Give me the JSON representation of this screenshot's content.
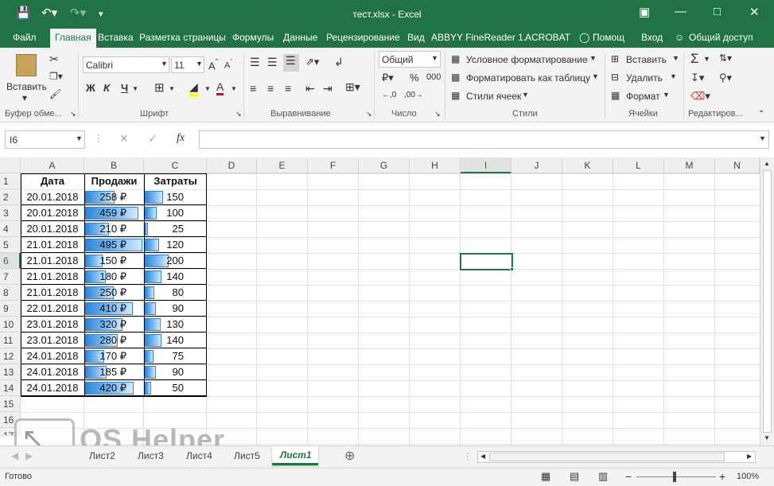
{
  "window": {
    "title": "тест.xlsx - Excel"
  },
  "ribbon_tabs": [
    "Файл",
    "Главная",
    "Вставка",
    "Разметка страницы",
    "Формулы",
    "Данные",
    "Рецензирование",
    "Вид",
    "ABBYY FineReader 1.",
    "ACROBAT",
    "Помощ",
    "Вход",
    "Общий доступ"
  ],
  "ribbon": {
    "paste": "Вставить",
    "font_name": "Calibri",
    "font_size": "11",
    "bold": "Ж",
    "italic": "К",
    "underline": "Ч",
    "number_format": "Общий",
    "percent": "%",
    "thousands": "000",
    "cond_format": "Условное форматирование",
    "format_table": "Форматировать как таблицу",
    "cell_styles": "Стили ячеек",
    "insert": "Вставить",
    "delete": "Удалить",
    "format": "Формат",
    "groups": [
      "Буфер обме...",
      "Шрифт",
      "Выравнивание",
      "Число",
      "Стили",
      "Ячейки",
      "Редактиров..."
    ]
  },
  "formula_bar": {
    "name_box": "I6",
    "fx": "fx",
    "formula": ""
  },
  "columns": [
    "A",
    "B",
    "C",
    "D",
    "E",
    "F",
    "G",
    "H",
    "I",
    "J",
    "K",
    "L",
    "M",
    "N"
  ],
  "rows": [
    "1",
    "2",
    "3",
    "4",
    "5",
    "6",
    "7",
    "8",
    "9",
    "10",
    "11",
    "12",
    "13",
    "14",
    "15",
    "16",
    "17"
  ],
  "table": {
    "headers": [
      "Дата",
      "Продажи",
      "Затраты"
    ],
    "rows": [
      {
        "date": "20.01.2018",
        "sales": "258 ₽",
        "cost": "150",
        "sales_fill": 0.52,
        "cost_fill": 0.75
      },
      {
        "date": "20.01.2018",
        "sales": "459 ₽",
        "cost": "100",
        "sales_fill": 0.93,
        "cost_fill": 0.5
      },
      {
        "date": "20.01.2018",
        "sales": "210 ₽",
        "cost": "25",
        "sales_fill": 0.42,
        "cost_fill": 0.13
      },
      {
        "date": "21.01.2018",
        "sales": "495 ₽",
        "cost": "120",
        "sales_fill": 1.0,
        "cost_fill": 0.6
      },
      {
        "date": "21.01.2018",
        "sales": "150 ₽",
        "cost": "200",
        "sales_fill": 0.3,
        "cost_fill": 1.0
      },
      {
        "date": "21.01.2018",
        "sales": "180 ₽",
        "cost": "140",
        "sales_fill": 0.36,
        "cost_fill": 0.7
      },
      {
        "date": "21.01.2018",
        "sales": "250 ₽",
        "cost": "80",
        "sales_fill": 0.5,
        "cost_fill": 0.4
      },
      {
        "date": "22.01.2018",
        "sales": "410 ₽",
        "cost": "90",
        "sales_fill": 0.83,
        "cost_fill": 0.45
      },
      {
        "date": "23.01.2018",
        "sales": "320 ₽",
        "cost": "130",
        "sales_fill": 0.65,
        "cost_fill": 0.65
      },
      {
        "date": "23.01.2018",
        "sales": "280 ₽",
        "cost": "140",
        "sales_fill": 0.57,
        "cost_fill": 0.7
      },
      {
        "date": "24.01.2018",
        "sales": "170 ₽",
        "cost": "75",
        "sales_fill": 0.34,
        "cost_fill": 0.38
      },
      {
        "date": "24.01.2018",
        "sales": "185 ₽",
        "cost": "90",
        "sales_fill": 0.37,
        "cost_fill": 0.45
      },
      {
        "date": "24.01.2018",
        "sales": "420 ₽",
        "cost": "50",
        "sales_fill": 0.85,
        "cost_fill": 0.25
      }
    ]
  },
  "sheets": [
    "Лист2",
    "Лист3",
    "Лист4",
    "Лист5",
    "Лист1"
  ],
  "active_sheet": "Лист1",
  "watermark": "OS Helper",
  "status": {
    "ready": "Готово",
    "zoom": "100%"
  },
  "colors": {
    "excel_green": "#217346",
    "bar_blue": "#2f86d8"
  }
}
